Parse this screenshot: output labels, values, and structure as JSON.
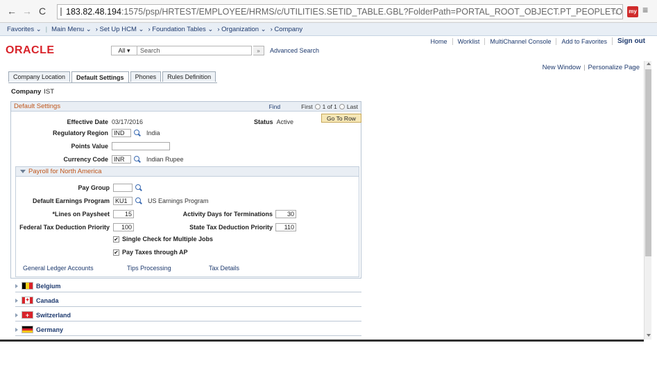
{
  "browser": {
    "url_host": "183.82.48.194",
    "url_path": ":1575/psp/HRTEST/EMPLOYEE/HRMS/c/UTILITIES.SETID_TABLE.GBL?FolderPath=PORTAL_ROOT_OBJECT.PT_PEOPLETOOLS.PT_UTILITIES.PT_ADMINISTI"
  },
  "nav": {
    "favorites": "Favorites ⌄",
    "main_menu": "Main Menu ⌄",
    "crumb1": "› Set Up HCM ⌄",
    "crumb2": "› Foundation Tables ⌄",
    "crumb3": "› Organization ⌄",
    "crumb4": "› Company"
  },
  "header": {
    "logo": "ORACLE",
    "search_scope": "All ▾",
    "search_placeholder": "Search",
    "search_go": "»",
    "advanced_search": "Advanced Search",
    "links": [
      "Home",
      "Worklist",
      "MultiChannel Console",
      "Add to Favorites",
      "Sign out"
    ]
  },
  "page_links": {
    "new_window": "New Window",
    "personalize": "Personalize Page"
  },
  "tabs": [
    "Company Location",
    "Default Settings",
    "Phones",
    "Rules Definition"
  ],
  "company": {
    "label": "Company",
    "value": "IST"
  },
  "default_settings": {
    "title": "Default Settings",
    "find": "Find",
    "first": "First",
    "pager": "1 of 1",
    "last": "Last",
    "goto_row": "Go To Row",
    "effective_date_label": "Effective Date",
    "effective_date": "03/17/2016",
    "status_label": "Status",
    "status": "Active",
    "reg_region_label": "Regulatory Region",
    "reg_region": "IND",
    "reg_region_desc": "India",
    "points_label": "Points Value",
    "points": "",
    "currency_label": "Currency Code",
    "currency": "INR",
    "currency_desc": "Indian Rupee"
  },
  "payroll": {
    "title": "Payroll for North America",
    "pay_group_label": "Pay Group",
    "pay_group": "",
    "earnings_label": "Default Earnings Program",
    "earnings": "KU1",
    "earnings_desc": "US Earnings Program",
    "lines_label": "*Lines on Paysheet",
    "lines": "15",
    "activity_label": "Activity Days for Terminations",
    "activity": "30",
    "fed_label": "Federal Tax Deduction Priority",
    "fed": "100",
    "state_label": "State Tax Deduction Priority",
    "state": "110",
    "single_check": "Single Check for Multiple Jobs",
    "pay_taxes": "Pay Taxes through AP",
    "gl_link": "General Ledger Accounts",
    "tips_link": "Tips Processing",
    "tax_link": "Tax Details"
  },
  "countries": [
    "Belgium",
    "Canada",
    "Switzerland",
    "Germany"
  ],
  "colors": {
    "oracle_red": "#d8232a",
    "section_title": "#c0561b",
    "link": "#1e3a6e"
  }
}
